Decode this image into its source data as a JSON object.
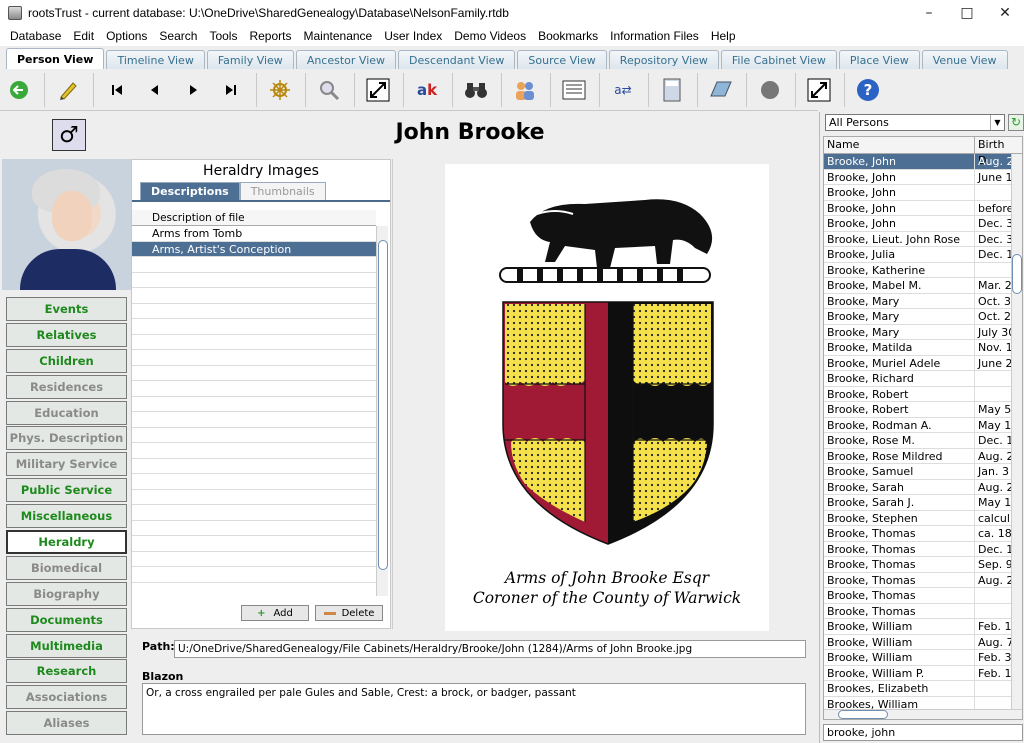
{
  "window": {
    "title": "rootsTrust - current database: U:\\OneDrive\\SharedGenealogy\\Database\\NelsonFamily.rtdb"
  },
  "menu": [
    "Database",
    "Edit",
    "Options",
    "Search",
    "Tools",
    "Reports",
    "Maintenance",
    "User Index",
    "Demo Videos",
    "Bookmarks",
    "Information Files",
    "Help"
  ],
  "views": [
    "Person View",
    "Timeline View",
    "Family View",
    "Ancestor View",
    "Descendant View",
    "Source View",
    "Repository View",
    "File Cabinet View",
    "Place View",
    "Venue View"
  ],
  "active_view": "Person View",
  "toolbar_icons": [
    "back-arrow-icon",
    "pencil-icon",
    "first-record-icon",
    "previous-record-icon",
    "next-record-icon",
    "last-record-icon",
    "ship-wheel-icon",
    "search-people-icon",
    "expand-icon",
    "spell-check-icon",
    "binoculars-icon",
    "people-icon",
    "list-icon",
    "translate-icon",
    "calculator-icon",
    "book-icon",
    "ear-icon",
    "fullscreen-icon",
    "help-icon"
  ],
  "person": {
    "name": "John Brooke",
    "gender_symbol": "♂"
  },
  "categories": [
    {
      "label": "Events",
      "style": "green"
    },
    {
      "label": "Relatives",
      "style": "green"
    },
    {
      "label": "Children",
      "style": "green"
    },
    {
      "label": "Residences",
      "style": "dim"
    },
    {
      "label": "Education",
      "style": "dim"
    },
    {
      "label": "Phys. Description",
      "style": "dim"
    },
    {
      "label": "Military Service",
      "style": "dim"
    },
    {
      "label": "Public Service",
      "style": "green"
    },
    {
      "label": "Miscellaneous",
      "style": "green"
    },
    {
      "label": "Heraldry",
      "style": "selected"
    },
    {
      "label": "Biomedical",
      "style": "dim"
    },
    {
      "label": "Biography",
      "style": "dim"
    },
    {
      "label": "Documents",
      "style": "green"
    },
    {
      "label": "Multimedia",
      "style": "green"
    },
    {
      "label": "Research",
      "style": "green"
    },
    {
      "label": "Associations",
      "style": "dim"
    },
    {
      "label": "Aliases",
      "style": "dim"
    }
  ],
  "heraldry": {
    "title": "Heraldry Images",
    "tabs": [
      "Descriptions",
      "Thumbnails"
    ],
    "column_header": "Description of file",
    "files": [
      "Arms from Tomb",
      "Arms, Artist's Conception"
    ],
    "selected_index": 1,
    "add_label": "Add",
    "delete_label": "Delete"
  },
  "preview": {
    "caption_line1": "Arms of John Brooke Esqr",
    "caption_line2": "Coroner of the County of Warwick"
  },
  "path": {
    "label": "Path:",
    "value": "U:/OneDrive/SharedGenealogy/File Cabinets/Heraldry/Brooke/John (1284)/Arms of John Brooke.jpg"
  },
  "blazon": {
    "label": "Blazon",
    "value": "Or, a cross engrailed per pale Gules and Sable, Crest: a brock, or badger, passant"
  },
  "right_panel": {
    "filter": "All Persons",
    "col_name": "Name",
    "col_birth": "Birth D",
    "search_value": "brooke, john",
    "persons": [
      {
        "name": "Brooke, John",
        "birth": "Aug. 2"
      },
      {
        "name": "Brooke, John",
        "birth": "June 1"
      },
      {
        "name": "Brooke, John",
        "birth": ""
      },
      {
        "name": "Brooke, John",
        "birth": "before"
      },
      {
        "name": "Brooke, John",
        "birth": "Dec. 3"
      },
      {
        "name": "Brooke, Lieut. John Rose",
        "birth": "Dec. 3"
      },
      {
        "name": "Brooke, Julia",
        "birth": "Dec. 1"
      },
      {
        "name": "Brooke, Katherine",
        "birth": ""
      },
      {
        "name": "Brooke, Mabel M.",
        "birth": "Mar. 2"
      },
      {
        "name": "Brooke, Mary",
        "birth": "Oct. 3"
      },
      {
        "name": "Brooke, Mary",
        "birth": "Oct. 2"
      },
      {
        "name": "Brooke, Mary",
        "birth": "July 30"
      },
      {
        "name": "Brooke, Matilda",
        "birth": "Nov. 1"
      },
      {
        "name": "Brooke, Muriel Adele",
        "birth": "June 2"
      },
      {
        "name": "Brooke, Richard",
        "birth": ""
      },
      {
        "name": "Brooke, Robert",
        "birth": ""
      },
      {
        "name": "Brooke, Robert",
        "birth": "May 5"
      },
      {
        "name": "Brooke, Rodman A.",
        "birth": "May 1"
      },
      {
        "name": "Brooke, Rose M.",
        "birth": "Dec. 1"
      },
      {
        "name": "Brooke, Rose Mildred",
        "birth": "Aug. 2"
      },
      {
        "name": "Brooke, Samuel",
        "birth": "Jan. 3"
      },
      {
        "name": "Brooke, Sarah",
        "birth": "Aug. 2"
      },
      {
        "name": "Brooke, Sarah J.",
        "birth": "May 1"
      },
      {
        "name": "Brooke, Stephen",
        "birth": "calcul"
      },
      {
        "name": "Brooke, Thomas",
        "birth": "ca. 18"
      },
      {
        "name": "Brooke, Thomas",
        "birth": "Dec. 1"
      },
      {
        "name": "Brooke, Thomas",
        "birth": "Sep. 9"
      },
      {
        "name": "Brooke, Thomas",
        "birth": "Aug. 2"
      },
      {
        "name": "Brooke, Thomas",
        "birth": ""
      },
      {
        "name": "Brooke, Thomas",
        "birth": ""
      },
      {
        "name": "Brooke, William",
        "birth": "Feb. 1"
      },
      {
        "name": "Brooke, William",
        "birth": "Aug. 7"
      },
      {
        "name": "Brooke, William",
        "birth": "Feb. 3"
      },
      {
        "name": "Brooke, William P.",
        "birth": "Feb. 1"
      },
      {
        "name": "Brookes, Elizabeth",
        "birth": ""
      },
      {
        "name": "Brookes, William",
        "birth": ""
      }
    ],
    "selected_index": 0
  }
}
